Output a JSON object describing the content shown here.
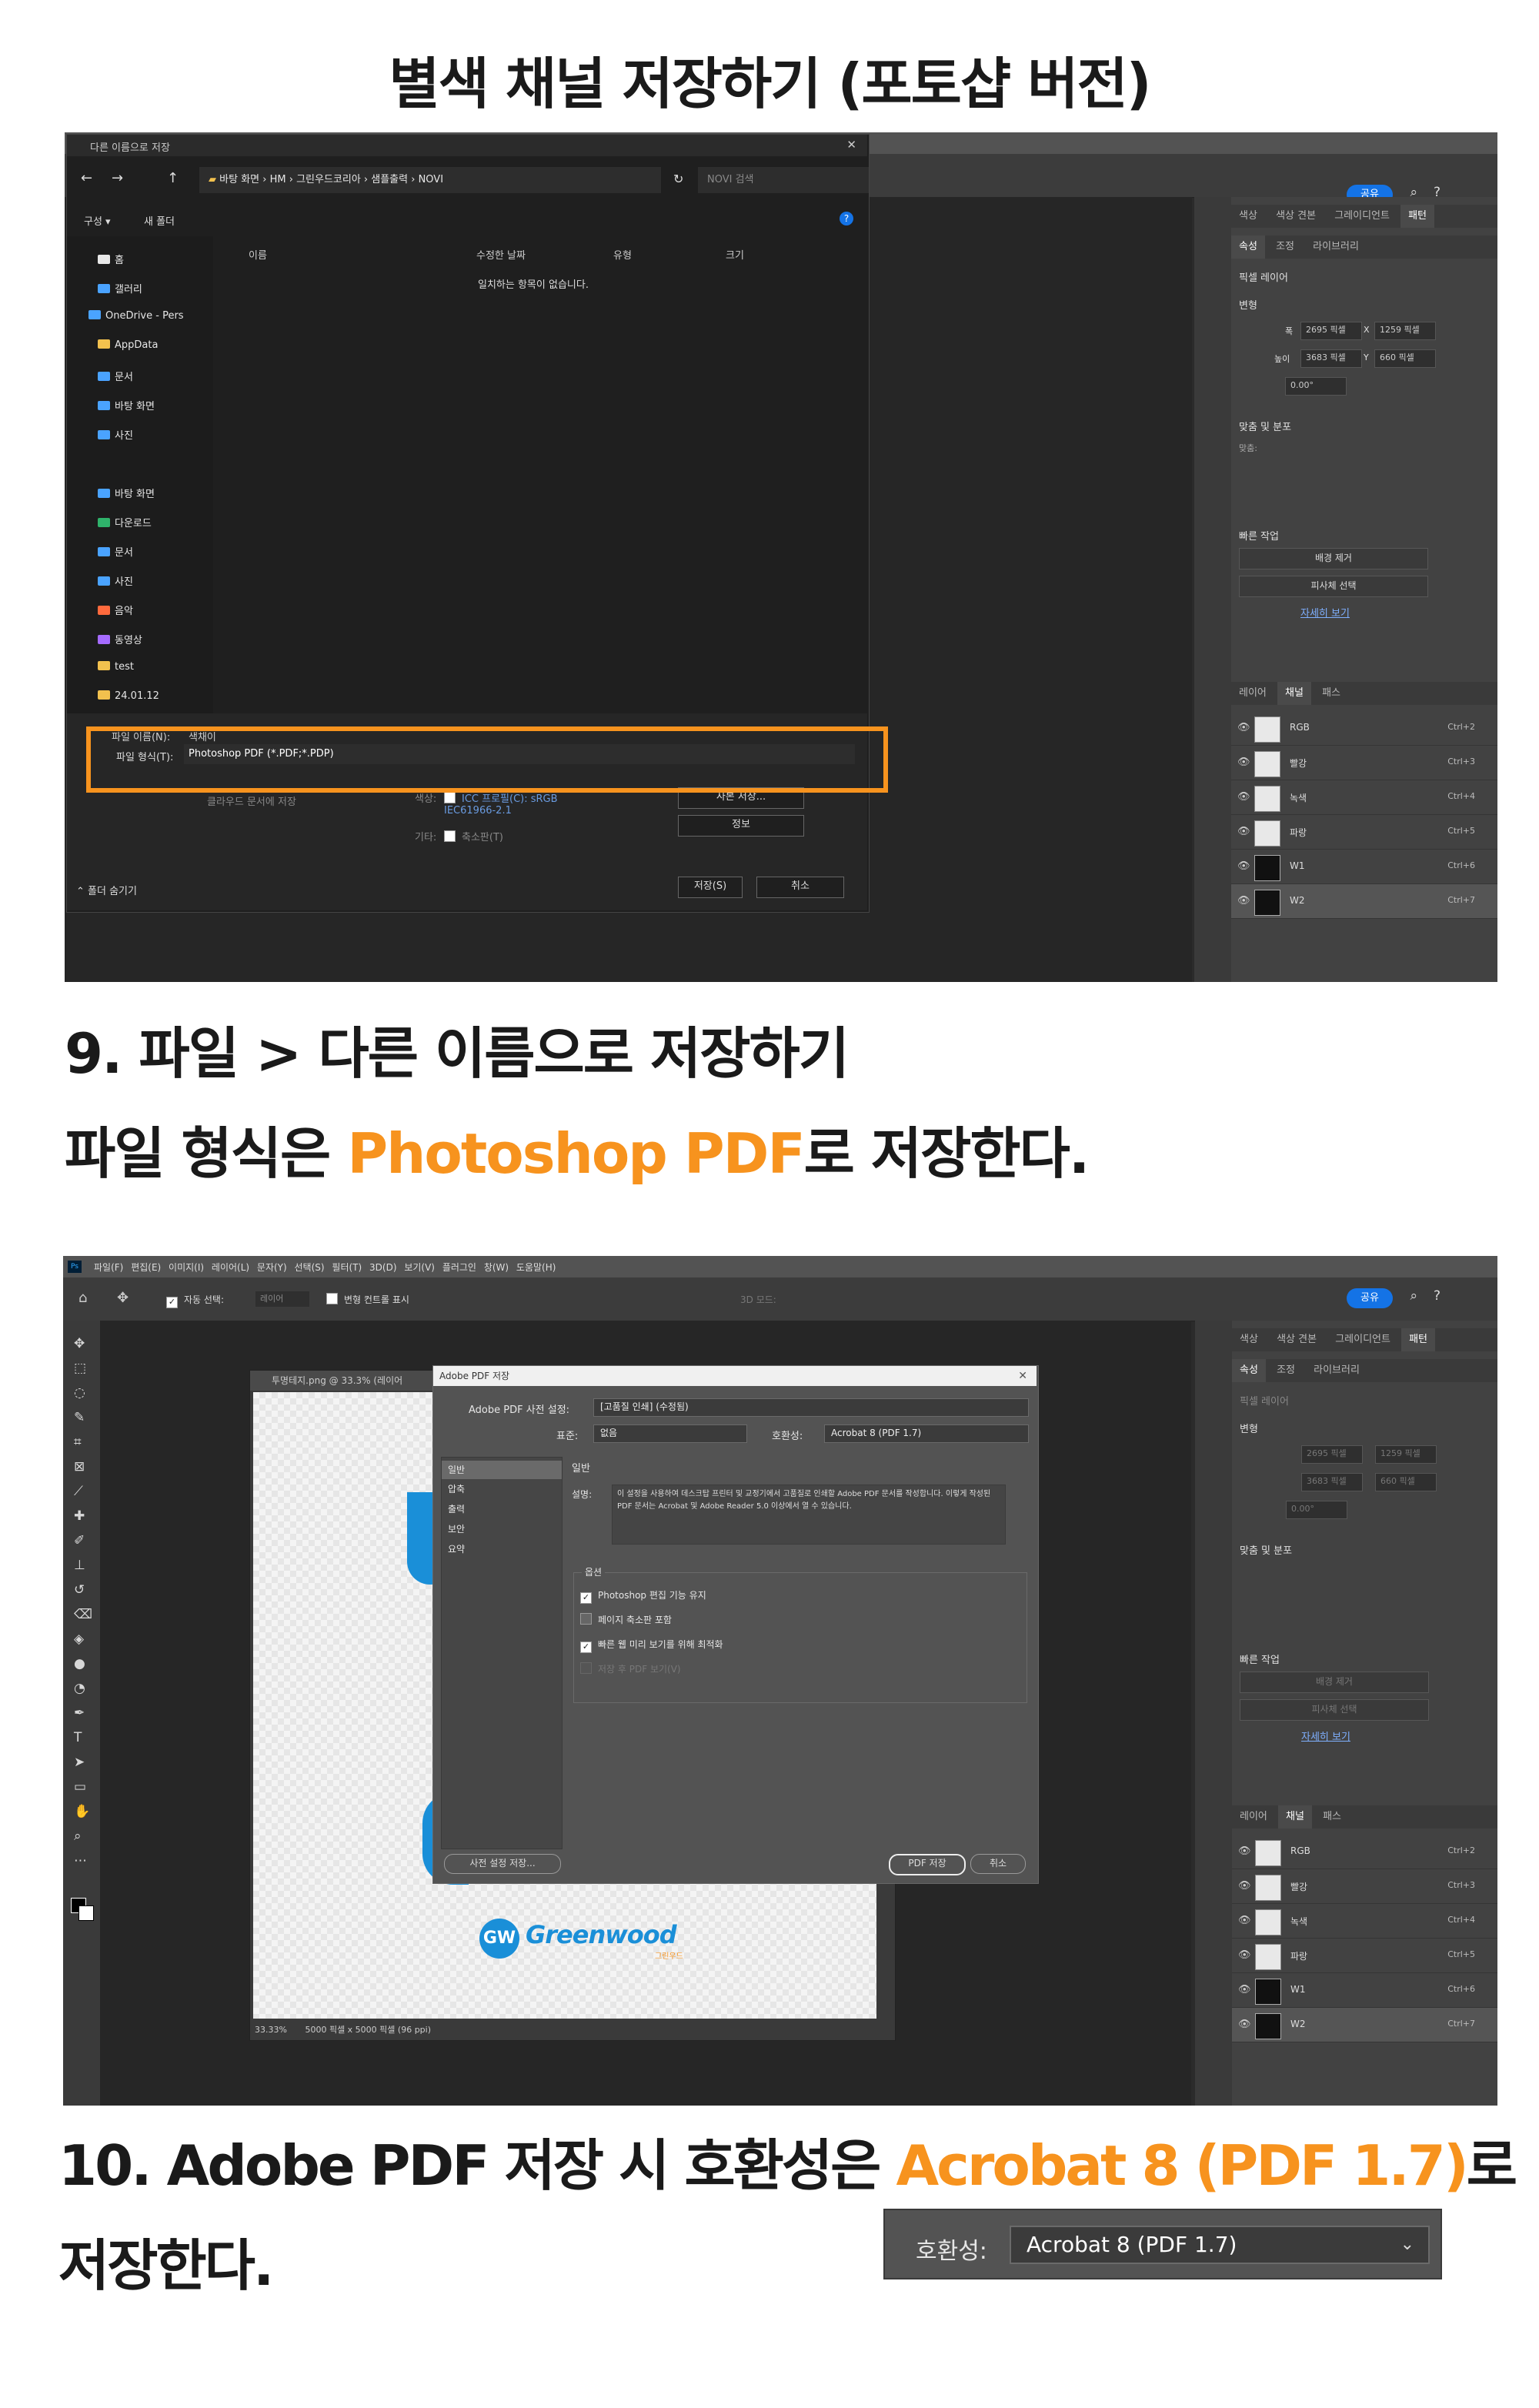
{
  "headings": {
    "title": "별색 채널 저장하기 (포토샵 버전)",
    "step9_line1": "9. 파일 > 다른 이름으로 저장하기",
    "step9_line2_pre": "파일 형식은 ",
    "step9_line2_hl": "Photoshop PDF",
    "step9_line2_post": "로 저장한다.",
    "step10_pre": "10. Adobe PDF 저장 시 호환성은 ",
    "step10_hl": "Acrobat 8 (PDF 1.7)",
    "step10_post": "로",
    "step10_line2": "저장한다."
  },
  "colors": {
    "accent": "#f7931e",
    "ps_blue": "#1473e6",
    "dark": "#1a1a1a"
  },
  "ps_common": {
    "share": "공유",
    "menu": [
      "파일(F)",
      "편집(E)",
      "이미지(I)",
      "레이어(L)",
      "문자(Y)",
      "선택(S)",
      "필터(T)",
      "3D(D)",
      "보기(V)",
      "플러그인",
      "창(W)",
      "도움말(H)"
    ],
    "auto_select": "자동 선택:",
    "layer_sel": "레이어",
    "transform_ctrl": "변형 컨트롤 표시",
    "mode3d": "3D 모드:",
    "props_tabs": [
      "색상",
      "색상 견본",
      "그레이디언트",
      "패턴"
    ],
    "props_tabs2": [
      "속성",
      "조정",
      "라이브러리"
    ],
    "pixel_layer": "픽셀 레이어",
    "transform": "변형",
    "w_label": "폭",
    "w_val": "2695 픽셀",
    "x_label": "X",
    "x_val": "1259 픽셀",
    "h_label": "높이",
    "h_val": "3683 픽셀",
    "y_label": "Y",
    "y_val": "660 픽셀",
    "angle_val": "0.00°",
    "align": "맞춤 및 분포",
    "align_label": "맞춤:",
    "quick": "빠른 작업",
    "remove_bg": "배경 제거",
    "select_subject": "피사체 선택",
    "more": "자세히 보기",
    "layer_tabs": [
      "레이어",
      "채널",
      "패스"
    ],
    "channels": [
      {
        "name": "RGB",
        "sc": "Ctrl+2",
        "dark": false
      },
      {
        "name": "빨강",
        "sc": "Ctrl+3",
        "dark": false
      },
      {
        "name": "녹색",
        "sc": "Ctrl+4",
        "dark": false
      },
      {
        "name": "파랑",
        "sc": "Ctrl+5",
        "dark": false
      },
      {
        "name": "W1",
        "sc": "Ctrl+6",
        "dark": true
      },
      {
        "name": "W2",
        "sc": "Ctrl+7",
        "dark": true
      }
    ]
  },
  "save_dialog": {
    "title": "다른 이름으로 저장",
    "path": [
      "바탕 화면",
      "HM",
      "그린우드코리아",
      "샘플출력",
      "NOVI"
    ],
    "search_placeholder": "NOVI 검색",
    "organize": "구성 ▾",
    "new_folder": "새 폴더",
    "nav": [
      {
        "label": "홈",
        "color": "#e8e8e8"
      },
      {
        "label": "갤러리",
        "color": "#4aa3ff"
      },
      {
        "label": "OneDrive - Pers",
        "color": "#4aa3ff"
      },
      {
        "label": "AppData",
        "color": "#f2c14e"
      },
      {
        "label": "문서",
        "color": "#4aa3ff"
      },
      {
        "label": "바탕 화면",
        "color": "#4aa3ff"
      },
      {
        "label": "사진",
        "color": "#4aa3ff"
      },
      {
        "label": "바탕 화면",
        "color": "#4aa3ff"
      },
      {
        "label": "다운로드",
        "color": "#2fb36b"
      },
      {
        "label": "문서",
        "color": "#4aa3ff"
      },
      {
        "label": "사진",
        "color": "#4aa3ff"
      },
      {
        "label": "음악",
        "color": "#ff6a3d"
      },
      {
        "label": "동영상",
        "color": "#a56bff"
      },
      {
        "label": "test",
        "color": "#f2c14e"
      },
      {
        "label": "24.01.12",
        "color": "#f2c14e"
      }
    ],
    "cols": [
      "이름",
      "수정한 날짜",
      "유형",
      "크기"
    ],
    "empty": "일치하는 항목이 없습니다.",
    "filename_label": "파일 이름(N):",
    "filename_val": "색채이",
    "filetype_label": "파일 형식(T):",
    "filetype_val": "Photoshop PDF (*.PDF;*.PDP)",
    "cloud_save": "클라우드 문서에 저장",
    "color_label": "색상:",
    "icc": "ICC 프로필(C): sRGB IEC61966-2.1",
    "other_label": "기타:",
    "thumbnail": "축소판(T)",
    "save_copy": "사본 저장...",
    "info": "정보",
    "hide_folders": "폴더 숨기기",
    "save": "저장(S)",
    "cancel": "취소"
  },
  "pdf_dialog": {
    "doc_tab": "투명테지.png @ 33.3% (레이어",
    "title": "Adobe PDF 저장",
    "preset_label": "Adobe PDF 사전 설정:",
    "preset_val": "[고품질 인쇄] (수정됨)",
    "standard_label": "표준:",
    "standard_val": "없음",
    "compat_label": "호환성:",
    "compat_val": "Acrobat 8 (PDF 1.7)",
    "side": [
      "일반",
      "압축",
      "출력",
      "보안",
      "요약"
    ],
    "section": "일반",
    "desc_label": "설명:",
    "desc": "이 설정을 사용하여 데스크탑 프린터 및 교정기에서 고품질로 인쇄할 Adobe PDF 문서를 작성합니다. 이렇게 작성된 PDF 문서는 Acrobat 및 Adobe Reader 5.0 이상에서 열 수 있습니다.",
    "options_label": "옵션",
    "opt1": "Photoshop 편집 기능 유지",
    "opt2": "페이지 축소판 포함",
    "opt3": "빠른 웹 미리 보기를 위해 최적화",
    "opt4": "저장 후 PDF 보기(V)",
    "preset_save": "사전 설정 저장...",
    "pdf_save": "PDF 저장",
    "cancel": "취소",
    "status_zoom": "33.33%",
    "status_size": "5000 픽셀 x 5000 픽셀 (96 ppi)",
    "logo_text": "Greenwood",
    "logo_sub": "그린우드"
  },
  "callout": {
    "label": "호환성:",
    "value": "Acrobat 8 (PDF 1.7)"
  }
}
